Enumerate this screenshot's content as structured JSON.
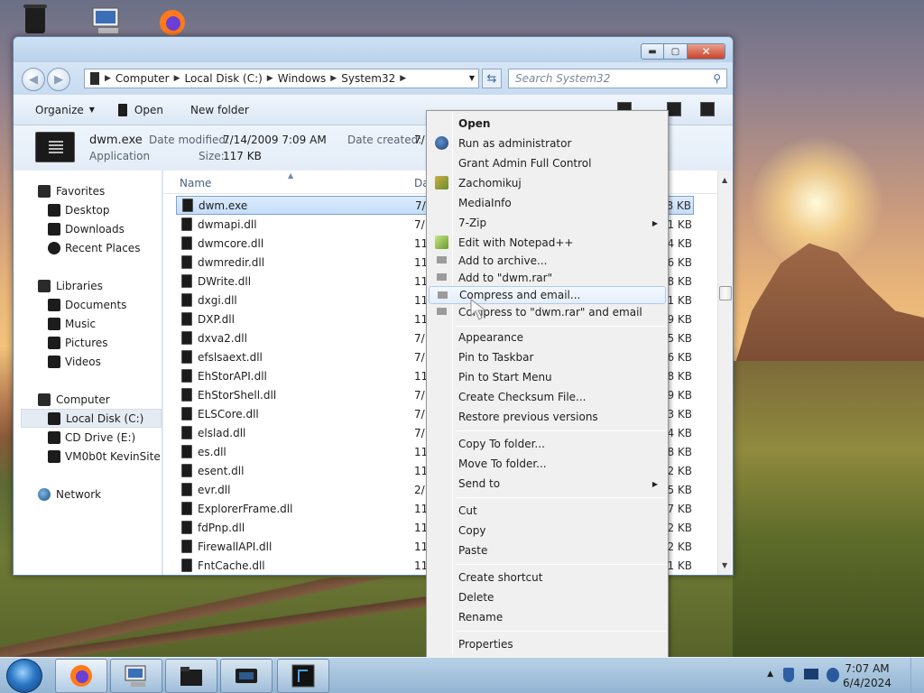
{
  "window": {
    "address_crumbs": [
      "Computer",
      "Local Disk (C:)",
      "Windows",
      "System32"
    ],
    "search_placeholder": "Search System32",
    "toolbar": {
      "organize": "Organize",
      "open": "Open",
      "new_folder": "New folder"
    },
    "details": {
      "name": "dwm.exe",
      "type": "Application",
      "date_modified_label": "Date modified:",
      "date_modified": "7/14/2009 7:09 AM",
      "size_label": "Size:",
      "size": "117 KB",
      "date_created_label": "Date created:",
      "date_created": "7/"
    },
    "nav": {
      "favorites": "Favorites",
      "desktop": "Desktop",
      "downloads": "Downloads",
      "recent_places": "Recent Places",
      "libraries": "Libraries",
      "documents": "Documents",
      "music": "Music",
      "pictures": "Pictures",
      "videos": "Videos",
      "computer": "Computer",
      "local_disk": "Local Disk (C:)",
      "cd_drive": "CD Drive (E:)",
      "vm_site": "VM0b0t KevinSite",
      "network": "Network"
    },
    "columns": {
      "name": "Name",
      "date": "Da"
    },
    "files": [
      {
        "name": "dwm.exe",
        "date": "7/",
        "size": "8 KB"
      },
      {
        "name": "dwmapi.dll",
        "date": "7/",
        "size": "1 KB"
      },
      {
        "name": "dwmcore.dll",
        "date": "11,",
        "size": "4 KB"
      },
      {
        "name": "dwmredir.dll",
        "date": "11,",
        "size": "6 KB"
      },
      {
        "name": "DWrite.dll",
        "date": "11,",
        "size": "8 KB"
      },
      {
        "name": "dxgi.dll",
        "date": "11,",
        "size": "1 KB"
      },
      {
        "name": "DXP.dll",
        "date": "11,",
        "size": "9 KB"
      },
      {
        "name": "dxva2.dll",
        "date": "7/",
        "size": "5 KB"
      },
      {
        "name": "efslsaext.dll",
        "date": "7/",
        "size": "6 KB"
      },
      {
        "name": "EhStorAPI.dll",
        "date": "11,",
        "size": "8 KB"
      },
      {
        "name": "EhStorShell.dll",
        "date": "7/",
        "size": "9 KB"
      },
      {
        "name": "ELSCore.dll",
        "date": "7/",
        "size": "3 KB"
      },
      {
        "name": "elslad.dll",
        "date": "7/",
        "size": "4 KB"
      },
      {
        "name": "es.dll",
        "date": "11,",
        "size": "8 KB"
      },
      {
        "name": "esent.dll",
        "date": "11,",
        "size": "2 KB"
      },
      {
        "name": "evr.dll",
        "date": "2/",
        "size": "5 KB"
      },
      {
        "name": "ExplorerFrame.dll",
        "date": "11,",
        "size": "7 KB"
      },
      {
        "name": "fdPnp.dll",
        "date": "11,",
        "size": "2 KB"
      },
      {
        "name": "FirewallAPI.dll",
        "date": "11,",
        "size": "2 KB"
      },
      {
        "name": "FntCache.dll",
        "date": "11,",
        "size": "1 KB"
      }
    ]
  },
  "context_menu": {
    "items": [
      "Open",
      "Run as administrator",
      "Grant Admin Full Control",
      "Zachomikuj",
      "MediaInfo",
      "7-Zip",
      "Edit with Notepad++",
      "Add to archive...",
      "Add to \"dwm.rar\"",
      "Compress and email...",
      "Compress to \"dwm.rar\" and email",
      "Appearance",
      "Pin to Taskbar",
      "Pin to Start Menu",
      "Create Checksum File...",
      "Restore previous versions",
      "Copy To folder...",
      "Move To folder...",
      "Send to",
      "Cut",
      "Copy",
      "Paste",
      "Create shortcut",
      "Delete",
      "Rename",
      "Properties"
    ]
  },
  "taskbar": {
    "time": "7:07 AM",
    "date": "6/4/2024"
  },
  "colors": {
    "window_bg": "#dfe9f5",
    "selection": "#c4ddf8",
    "menu_bg": "#f0f0f0",
    "close_red": "#c9432c"
  }
}
